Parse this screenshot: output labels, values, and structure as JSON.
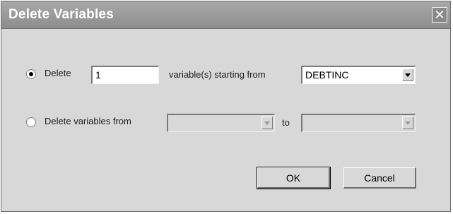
{
  "window": {
    "title": "Delete Variables",
    "close_icon": "close-icon"
  },
  "row1": {
    "radio_label": "Delete",
    "selected": true,
    "count_value": "1",
    "middle_label": "variable(s) starting from",
    "start_variable": "DEBTINC"
  },
  "row2": {
    "radio_label": "Delete variables from",
    "selected": false,
    "from_value": "",
    "to_label": "to",
    "to_value": ""
  },
  "buttons": {
    "ok_label": "OK",
    "cancel_label": "Cancel"
  },
  "colors": {
    "titlebar": "#9a9a9a",
    "dialog_bg": "#d8d8d8"
  }
}
